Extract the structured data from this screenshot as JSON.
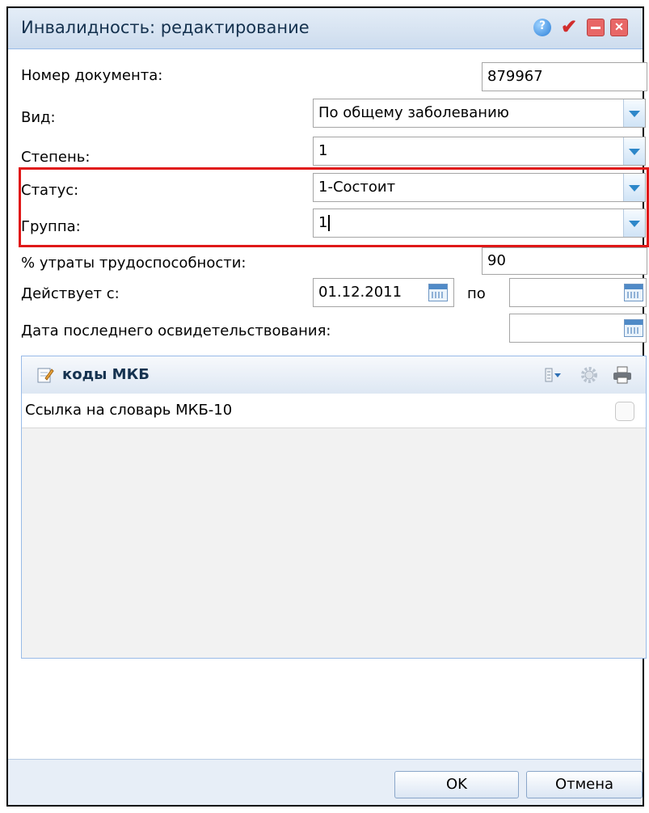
{
  "window": {
    "title": "Инвалидность: редактирование"
  },
  "form": {
    "doc_number_label": "Номер документа:",
    "doc_number_value": "879967",
    "type_label": "Вид:",
    "type_value": "По общему заболеванию",
    "degree_label": "Степень:",
    "degree_value": "1",
    "status_label": "Статус:",
    "status_value": "1-Состоит",
    "group_label": "Группа:",
    "group_value": "1",
    "loss_label": "% утраты трудоспособности:",
    "loss_value": "90",
    "valid_from_label": "Действует с:",
    "valid_from_value": "01.12.2011",
    "valid_to_label": "по",
    "valid_to_value": "",
    "last_exam_label": "Дата последнего освидетельствования:",
    "last_exam_value": ""
  },
  "mkb_panel": {
    "title": "коды МКБ",
    "row_label": "Ссылка на словарь МКБ-10"
  },
  "buttons": {
    "ok": "OK",
    "cancel": "Отмена"
  },
  "colors": {
    "highlight": "#e01818",
    "accent": "#2d87c9"
  }
}
